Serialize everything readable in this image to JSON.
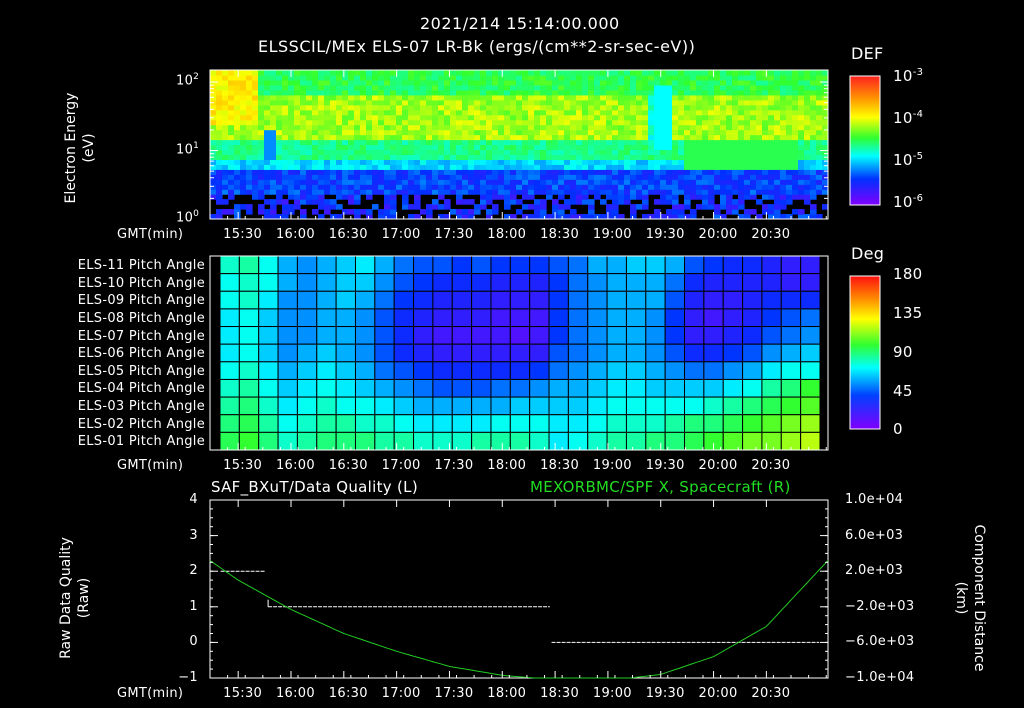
{
  "header": {
    "timestamp": "2021/214 15:14:00.000",
    "subtitle": "ELSSCIL/MEx ELS-07 LR-Bk   (ergs/(cm**2-sr-sec-eV))"
  },
  "gmt_label": "GMT(min)",
  "time_ticks": [
    "15:30",
    "16:00",
    "16:30",
    "17:00",
    "17:30",
    "18:00",
    "18:30",
    "19:00",
    "19:30",
    "20:00",
    "20:30"
  ],
  "chart_data": [
    {
      "type": "heatmap",
      "name": "spectrogram",
      "ylabel": [
        "Electron Energy",
        "(eV)"
      ],
      "yscale": "log",
      "ylim": [
        1,
        150
      ],
      "y_ticks": [
        {
          "base": "10",
          "exp": "0",
          "v": 1
        },
        {
          "base": "10",
          "exp": "1",
          "v": 10
        },
        {
          "base": "10",
          "exp": "2",
          "v": 100
        }
      ],
      "x_range": [
        "15:14",
        "21:05"
      ],
      "colorbar": {
        "label": "DEF",
        "ticks": [
          {
            "base": "10",
            "exp": "-3"
          },
          {
            "base": "10",
            "exp": "-4"
          },
          {
            "base": "10",
            "exp": "-5"
          },
          {
            "base": "10",
            "exp": "-6"
          }
        ]
      }
    },
    {
      "type": "heatmap",
      "name": "pitch-angle",
      "row_labels": [
        "ELS-11 Pitch Angle",
        "ELS-10 Pitch Angle",
        "ELS-09 Pitch Angle",
        "ELS-08 Pitch Angle",
        "ELS-07 Pitch Angle",
        "ELS-06 Pitch Angle",
        "ELS-05 Pitch Angle",
        "ELS-04 Pitch Angle",
        "ELS-03 Pitch Angle",
        "ELS-02 Pitch Angle",
        "ELS-01 Pitch Angle"
      ],
      "colorbar": {
        "label": "Deg",
        "ticks": [
          "180",
          "135",
          "90",
          "45",
          "0"
        ]
      },
      "approx_values_deg": [
        [
          75,
          80,
          70,
          55,
          50,
          55,
          60,
          65,
          55,
          45,
          40,
          40,
          35,
          40,
          35,
          35,
          35,
          40,
          45,
          55,
          55,
          60,
          60,
          55,
          40,
          35,
          30,
          30,
          25,
          20,
          20
        ],
        [
          70,
          75,
          70,
          55,
          50,
          55,
          60,
          60,
          50,
          40,
          35,
          30,
          30,
          30,
          25,
          25,
          25,
          35,
          45,
          50,
          55,
          55,
          55,
          45,
          30,
          25,
          25,
          25,
          25,
          20,
          20
        ],
        [
          70,
          75,
          65,
          50,
          50,
          55,
          60,
          55,
          45,
          35,
          30,
          25,
          25,
          25,
          20,
          20,
          20,
          35,
          45,
          50,
          55,
          55,
          55,
          40,
          25,
          20,
          20,
          25,
          30,
          30,
          30
        ],
        [
          65,
          70,
          60,
          50,
          50,
          55,
          55,
          50,
          40,
          30,
          25,
          20,
          20,
          20,
          15,
          15,
          15,
          35,
          45,
          50,
          55,
          55,
          50,
          35,
          20,
          15,
          20,
          25,
          35,
          40,
          45
        ],
        [
          65,
          70,
          60,
          50,
          50,
          55,
          55,
          50,
          40,
          30,
          20,
          15,
          15,
          15,
          15,
          10,
          15,
          35,
          45,
          50,
          55,
          55,
          50,
          35,
          20,
          20,
          25,
          30,
          40,
          45,
          50
        ],
        [
          65,
          70,
          60,
          50,
          55,
          60,
          55,
          50,
          40,
          30,
          25,
          20,
          20,
          20,
          20,
          20,
          20,
          40,
          45,
          50,
          55,
          55,
          50,
          40,
          30,
          30,
          35,
          40,
          50,
          55,
          60
        ],
        [
          70,
          75,
          65,
          55,
          60,
          65,
          60,
          55,
          45,
          40,
          35,
          30,
          30,
          30,
          30,
          30,
          35,
          45,
          50,
          55,
          60,
          60,
          55,
          50,
          45,
          45,
          50,
          55,
          65,
          70,
          70
        ],
        [
          75,
          80,
          70,
          60,
          65,
          70,
          65,
          60,
          55,
          50,
          45,
          40,
          40,
          40,
          45,
          45,
          50,
          55,
          55,
          60,
          65,
          65,
          60,
          60,
          60,
          60,
          65,
          70,
          80,
          85,
          95
        ],
        [
          80,
          85,
          75,
          65,
          70,
          75,
          70,
          70,
          65,
          60,
          55,
          55,
          55,
          55,
          55,
          60,
          60,
          60,
          60,
          65,
          70,
          70,
          70,
          70,
          70,
          75,
          80,
          85,
          90,
          95,
          100
        ],
        [
          85,
          90,
          80,
          70,
          75,
          80,
          80,
          75,
          75,
          70,
          65,
          65,
          65,
          65,
          70,
          70,
          70,
          65,
          65,
          70,
          75,
          75,
          75,
          80,
          85,
          85,
          90,
          95,
          100,
          105,
          110
        ],
        [
          90,
          95,
          85,
          75,
          80,
          85,
          85,
          85,
          80,
          80,
          75,
          75,
          75,
          80,
          80,
          80,
          75,
          65,
          70,
          75,
          80,
          80,
          85,
          85,
          90,
          95,
          100,
          105,
          105,
          110,
          115
        ]
      ]
    },
    {
      "type": "line",
      "name": "data-quality",
      "title_left": "SAF_BXuT/Data Quality (L)",
      "title_right": "MEXORBMC/SPF X, Spacecraft (R)",
      "ylabel_left": [
        "Raw Data Quality",
        "(Raw)"
      ],
      "ylabel_right": [
        "Component Distance",
        "(km)"
      ],
      "left_ticks": [
        "4",
        "3",
        "2",
        "1",
        "0",
        "−1"
      ],
      "right_ticks": [
        "1.0e+04",
        "6.0e+03",
        "2.0e+03",
        "−2.0e+03",
        "−6.0e+03",
        "−1.0e+04"
      ],
      "ylim_left": [
        -1,
        4
      ],
      "ylim_right": [
        -10000,
        10000
      ],
      "quality_segments": [
        {
          "x0": "15:20",
          "x1": "15:45",
          "y": 2
        },
        {
          "x0": "15:47",
          "x1": "18:27",
          "y": 1
        },
        {
          "x0": "18:28",
          "x1": "21:00",
          "y": 0
        }
      ],
      "distance_km": {
        "t": [
          "15:14",
          "15:30",
          "16:00",
          "16:30",
          "17:00",
          "17:30",
          "18:00",
          "18:30",
          "19:00",
          "19:30",
          "20:00",
          "20:30",
          "21:05"
        ],
        "v": [
          3200,
          1000,
          -2300,
          -5000,
          -7000,
          -8700,
          -9700,
          -10200,
          -10300,
          -9600,
          -7600,
          -4200,
          3200
        ]
      },
      "colors": {
        "quality": "#ffffff",
        "distance": "#22cc22"
      }
    }
  ]
}
